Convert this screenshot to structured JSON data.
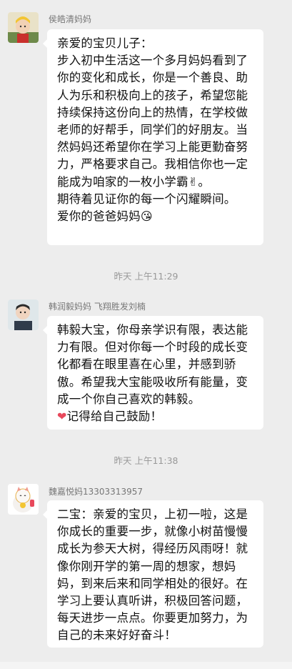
{
  "messages": [
    {
      "sender": "侯皓清妈妈",
      "paragraphs": [
        "亲爱的宝贝儿子：",
        "步入初中生活这一个多月妈妈看到了你的变化和成长，你是一个善良、助人为乐和积极向上的孩子，希望您能持续保持这份向上的热情，在学校做老师的好帮手，同学们的好朋友。当然妈妈还希望你在学习上能更勤奋努力，严格要求自己。我相信你也一定能成为咱家的一枚小学霸",
        "期待着见证你的每一个闪耀瞬间。",
        "爱你的爸爸妈妈"
      ],
      "emojis": [
        "✌",
        "😘"
      ]
    },
    {
      "sender": "韩润毅妈妈 飞翔胜发刘楠",
      "paragraphs": [
        "韩毅大宝，你母亲学识有限，表达能力有限。但对你每一个时段的成长变化都看在眼里喜在心里，并感到骄傲。希望我大宝能吸收所有能量，变成一个你自己喜欢的韩毅。",
        "记得给自己鼓励！"
      ],
      "emojis": [
        "❤"
      ]
    },
    {
      "sender": "魏嘉悦妈13303313957",
      "paragraphs": [
        "二宝：亲爱的宝贝，上初一啦，这是你成长的重要一步，就像小树苗慢慢成长为参天大树，得经历风雨呀！就像你刚开学的第一周的想家，想妈妈，到来后来和同学相处的很好。在学习上要认真听讲，积极回答问题，每天进步一点点。你要更加努力，为自己的未来好好奋斗！"
      ]
    }
  ],
  "timestamps": [
    "昨天 上午11:29",
    "昨天 上午11:38"
  ],
  "colors": {
    "background": "#ededed",
    "bubble": "#ffffff",
    "heart": "#e8485b"
  }
}
